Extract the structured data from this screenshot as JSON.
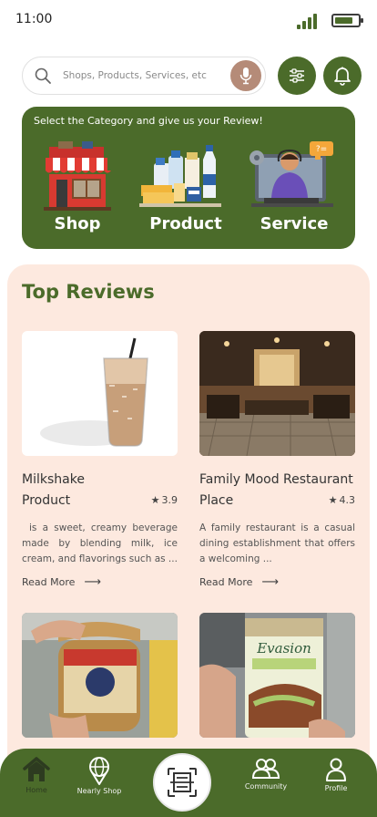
{
  "status_bar": {
    "time": "11:00",
    "battery_level": 0.8
  },
  "search": {
    "placeholder": "Shops, Products, Services, etc"
  },
  "icons": {
    "search": "search-icon",
    "mic": "microphone-icon",
    "filter": "sliders-icon",
    "notifications": "bell-icon",
    "rating": "star-icon",
    "read_more": "arrow-right-icon"
  },
  "categories": {
    "prompt": "Select the Category and give us your Review!",
    "items": [
      {
        "label": "Shop",
        "icon": "storefront-icon"
      },
      {
        "label": "Product",
        "icon": "groceries-icon"
      },
      {
        "label": "Service",
        "icon": "customer-service-icon"
      }
    ]
  },
  "top_reviews": {
    "title": "Top Reviews",
    "items": [
      {
        "name": "Milkshake",
        "category": "Product",
        "rating": "3.9",
        "description": "is a sweet, creamy beverage made by blending milk, ice cream, and flavorings such as ...",
        "read_more": "Read More",
        "image": "iced-coffee-milkshake-photo"
      },
      {
        "name": "Family Mood Restaurant",
        "category": "Place",
        "rating": "4.3",
        "description": "A family restaurant is a casual dining establishment that offers a welcoming ...",
        "read_more": "Read More",
        "image": "restaurant-interior-photo"
      },
      {
        "image": "spread-jar-photo"
      },
      {
        "image": "chocolate-bar-photo"
      }
    ]
  },
  "bottom_nav": {
    "items": [
      {
        "label": "Home",
        "icon": "home-icon",
        "active": true
      },
      {
        "label": "Nearly Shop",
        "icon": "globe-pin-icon"
      },
      {
        "label": "",
        "icon": "scan-icon"
      },
      {
        "label": "Community",
        "icon": "people-icon"
      },
      {
        "label": "Profile",
        "icon": "user-icon"
      }
    ]
  },
  "colors": {
    "brand": "#4b6b2a",
    "section_bg": "#fde9df",
    "mic": "#b58b78"
  }
}
